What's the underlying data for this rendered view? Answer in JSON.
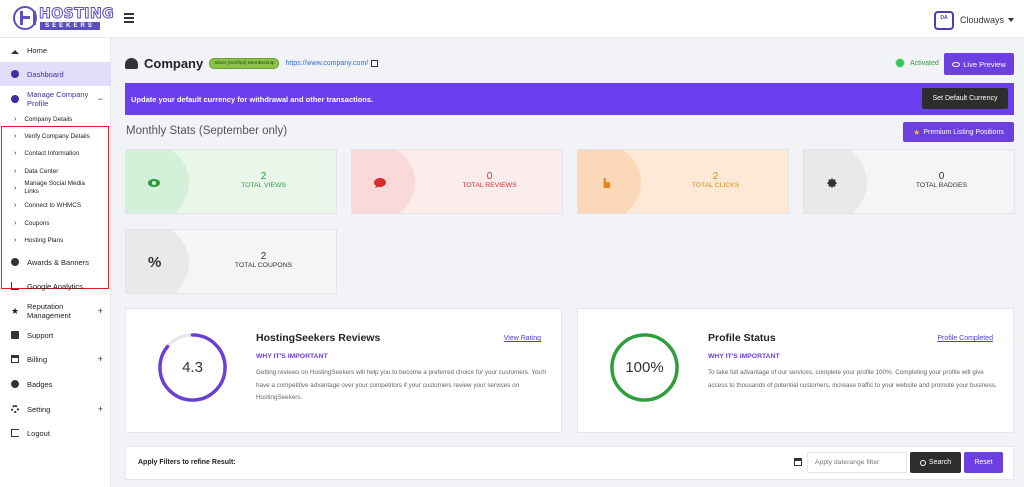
{
  "brand": {
    "name": "HOSTING",
    "sub": "SEEKERS"
  },
  "topbar": {
    "user_name": "Cloudways",
    "avatar_text": "DA"
  },
  "sidebar": {
    "items": [
      {
        "label": "Home",
        "icon": "home-icon"
      },
      {
        "label": "Dashboard",
        "icon": "dashboard-icon"
      },
      {
        "label": "Manage Company Profile",
        "icon": "info-icon",
        "toggle": "−"
      },
      {
        "label": "Awards & Banners",
        "icon": "award-icon"
      },
      {
        "label": "Google Analytics",
        "icon": "chart-icon"
      },
      {
        "label": "Reputation Management",
        "icon": "star-icon",
        "toggle": "+"
      },
      {
        "label": "Support",
        "icon": "support-icon"
      },
      {
        "label": "Billing",
        "icon": "billing-icon",
        "toggle": "+"
      },
      {
        "label": "Badges",
        "icon": "badge-icon"
      },
      {
        "label": "Setting",
        "icon": "gears-icon",
        "toggle": "+"
      },
      {
        "label": "Logout",
        "icon": "logout-icon"
      }
    ],
    "subitems": [
      "Company Details",
      "Verify Company Details",
      "Contact Information",
      "Data Center",
      "Manage Social Media Links",
      "Connect to WHMCS",
      "Coupons",
      "Hosting Plans"
    ]
  },
  "header": {
    "title": "Company",
    "badge": "Silver (Verified) Membership",
    "url": "https://www.company.com/",
    "status": "Activated",
    "live_preview": "Live Preview"
  },
  "banner": {
    "text": "Update your default currency for withdrawal and other transactions.",
    "button": "Set Default Currency"
  },
  "stats": {
    "title": "Monthly Stats (September only)",
    "premium_button": "Premium Listing Positions",
    "cards": [
      {
        "value": "2",
        "label": "TOTAL VIEWS",
        "icon": "eye-icon",
        "bg": "#e8f7ea",
        "bubble": "#d3f0d8",
        "color": "#2a9d3a"
      },
      {
        "value": "0",
        "label": "TOTAL REVIEWS",
        "icon": "comment-icon",
        "bg": "#fdecec",
        "bubble": "#fad9d9",
        "color": "#d32f2f"
      },
      {
        "value": "2",
        "label": "TOTAL CLICKS",
        "icon": "pointer-icon",
        "bg": "#fde9d6",
        "bubble": "#fbd9b8",
        "color": "#e08a1e"
      },
      {
        "value": "0",
        "label": "TOTAL BADGES",
        "icon": "badge-icon",
        "bg": "#f5f5f5",
        "bubble": "#e9e9e9",
        "color": "#333333"
      },
      {
        "value": "2",
        "label": "TOTAL COUPONS",
        "icon": "percent-icon",
        "bg": "#f5f5f5",
        "bubble": "#e9e9e9",
        "color": "#333333"
      }
    ]
  },
  "reviews": {
    "title": "HostingSeekers Reviews",
    "link": "View Rating",
    "rating": "4.3",
    "rating_fraction": 0.86,
    "why": "WHY IT'S IMPORTANT",
    "desc": "Getting reviews on HostingSeekers will help you to become a preferred choice for your customers. You'll have a competitive advantage over your competitors if your customers review your services on HostingSeekers."
  },
  "profile": {
    "title": "Profile Status",
    "link": "Profile Completed",
    "percent": "100%",
    "percent_fraction": 1.0,
    "why": "WHY IT'S IMPORTANT",
    "desc": "To take full advantage of our services, complete your profile 100%. Completing your profile will give access to thousands of potential customers, increase traffic to your website and promote your business."
  },
  "filters": {
    "label": "Apply Filters to refine Result:",
    "placeholder": "Apply daterange filter",
    "search": "Search",
    "reset": "Reset"
  },
  "colors": {
    "accent": "#6b3fe0",
    "ring_reviews": "#6a3fd6",
    "ring_profile": "#2e9e3c",
    "alert_border": "#d8232a"
  }
}
